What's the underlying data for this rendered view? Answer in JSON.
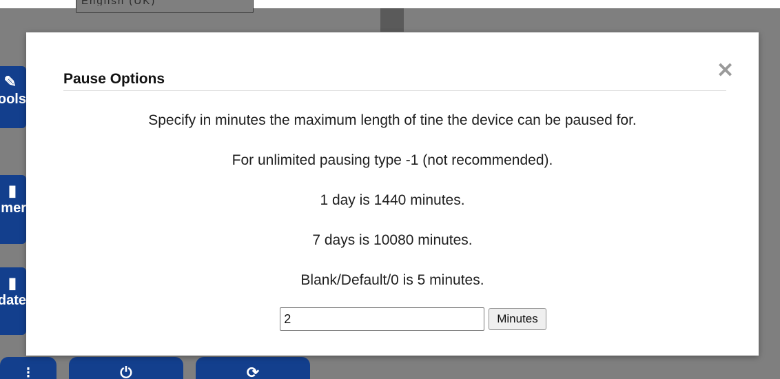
{
  "background": {
    "select_text": "English (UK)",
    "side_buttons": [
      {
        "icon": "tools-icon",
        "glyph": "✎",
        "label": "Tools"
      },
      {
        "icon": "timer-icon",
        "glyph": "▮",
        "label": "Timer"
      },
      {
        "icon": "update-icon",
        "glyph": "▮",
        "label": "Update"
      }
    ],
    "bottom_buttons": [
      {
        "icon": "settings-icon",
        "glyph": "⁝"
      },
      {
        "icon": "power-icon",
        "glyph": "⏻"
      },
      {
        "icon": "refresh-icon",
        "glyph": "⟳"
      }
    ]
  },
  "modal": {
    "title": "Pause Options",
    "close_glyph": "✕",
    "lines": [
      "Specify in minutes the maximum length of tine the device can be paused for.",
      "For unlimited pausing type -1 (not recommended).",
      "1 day is 1440 minutes.",
      "7 days is 10080 minutes.",
      "Blank/Default/0 is 5 minutes."
    ],
    "input_value": "2",
    "submit_label": "Minutes"
  },
  "colors": {
    "overlay": "#7f7f7f",
    "brand_blue": "#133f8d",
    "modal_bg": "#ffffff"
  }
}
